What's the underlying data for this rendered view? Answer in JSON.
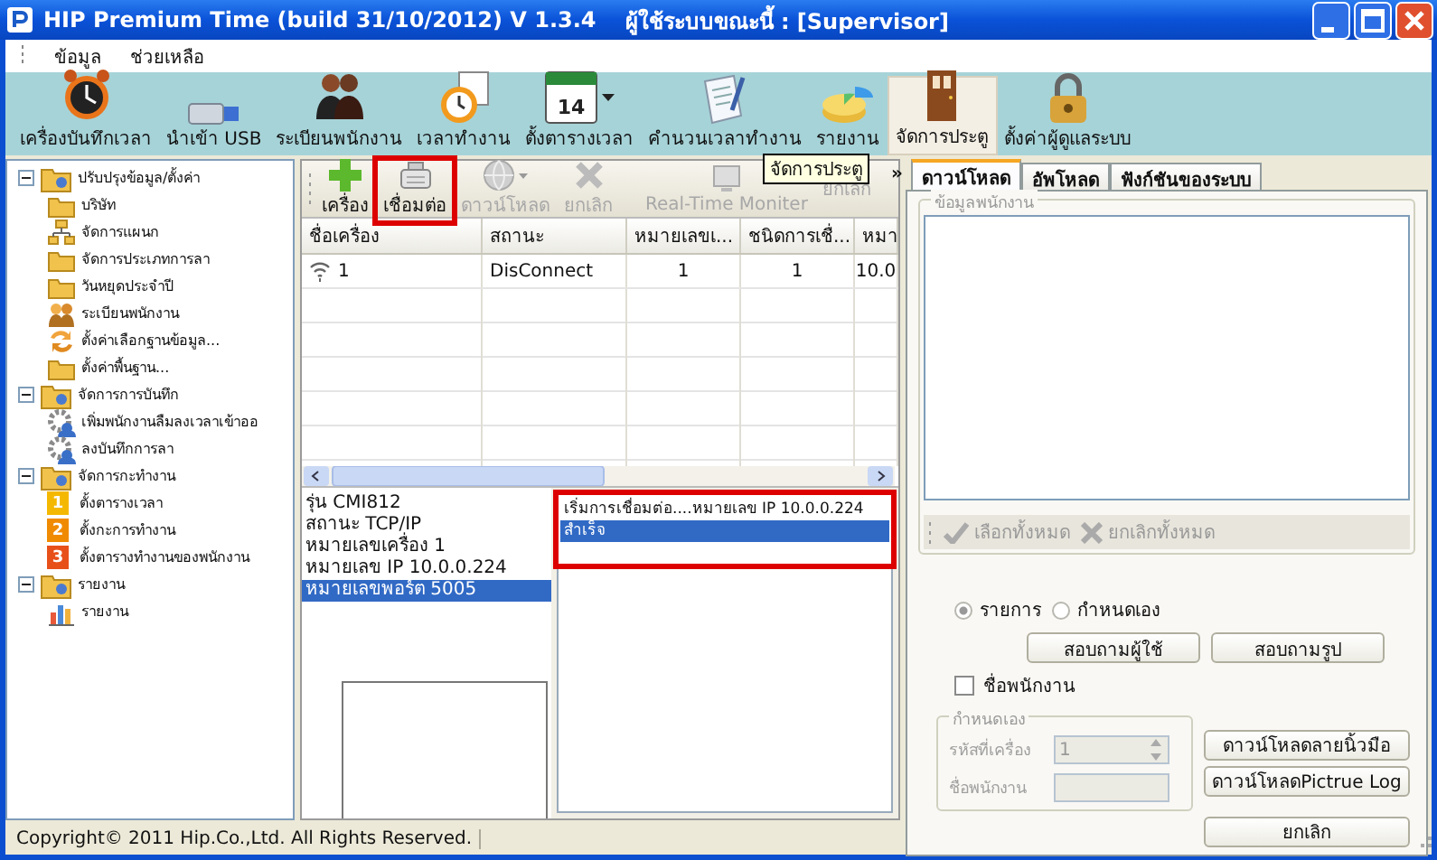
{
  "window": {
    "title": "HIP Premium Time (build 31/10/2012) V 1.3.4",
    "user": "ผู้ใช้ระบบขณะนี้ : [Supervisor]"
  },
  "menu": [
    "ข้อมูล",
    "ช่วยเหลือ"
  ],
  "toolbar": [
    {
      "label": "เครื่องบันทึกเวลา",
      "selected": false
    },
    {
      "label": "นำเข้า USB",
      "selected": false
    },
    {
      "label": "ระเบียนพนักงาน",
      "selected": false
    },
    {
      "label": "เวลาทำงาน",
      "selected": false
    },
    {
      "label": "ตั้งตารางเวลา",
      "badge": "14",
      "dropdown": true,
      "selected": false
    },
    {
      "label": "คำนวนเวลาทำงาน",
      "selected": false
    },
    {
      "label": "รายงาน",
      "selected": false
    },
    {
      "label": "จัดการประตู",
      "selected": true
    },
    {
      "label": "ตั้งค่าผู้ดูแลระบบ",
      "selected": false
    }
  ],
  "tree": [
    {
      "label": "ปรับปรุงข้อมูล/ตั้งค่า",
      "expanded": true,
      "children": [
        {
          "label": "บริษัท"
        },
        {
          "label": "จัดการแผนก"
        },
        {
          "label": "จัดการประเภทการลา"
        },
        {
          "label": "วันหยุดประจำปี"
        },
        {
          "label": "ระเบียนพนักงาน"
        },
        {
          "label": "ตั้งค่าเลือกฐานข้อมูล..."
        },
        {
          "label": "ตั้งค่าพื้นฐาน..."
        }
      ]
    },
    {
      "label": "จัดการการบันทึก",
      "expanded": true,
      "children": [
        {
          "label": "เพิ่มพนักงานลืมลงเวลาเข้าออ"
        },
        {
          "label": "ลงบันทึกการลา"
        }
      ]
    },
    {
      "label": "จัดการกะทำงาน",
      "expanded": true,
      "children": [
        {
          "label": "ตั้งตารางเวลา",
          "badge": "1",
          "color": "#f5b800"
        },
        {
          "label": "ตั้งกะการทำงาน",
          "badge": "2",
          "color": "#f08a00"
        },
        {
          "label": "ตั้งตารางทำงานของพนักงาน",
          "badge": "3",
          "color": "#e8501a"
        }
      ]
    },
    {
      "label": "รายงาน",
      "expanded": true,
      "children": [
        {
          "label": "รายงาน"
        }
      ]
    }
  ],
  "device_toolbar": {
    "buttons": [
      {
        "label": "เครื่อง",
        "disabled": false,
        "highlighted": false
      },
      {
        "label": "เชื่อมต่อ",
        "disabled": false,
        "highlighted": true
      },
      {
        "label": "ดาวน์โหลด",
        "disabled": true,
        "dropdown": true,
        "highlighted": false
      },
      {
        "label": "ยกเลิก",
        "disabled": true,
        "highlighted": false
      },
      {
        "label": "Real-Time Moniter",
        "disabled": true,
        "highlighted": false
      },
      {
        "label": "ยกเลิก",
        "disabled": true,
        "highlighted": false
      }
    ],
    "overflow": "»",
    "tooltip": "จัดการประตู"
  },
  "table": {
    "columns": [
      "ชื่อเครื่อง",
      "สถานะ",
      "หมายเลขเ...",
      "ชนิดการเชื่...",
      "หมา"
    ],
    "rows": [
      [
        "1",
        "DisConnect",
        "1",
        "1",
        "10.0"
      ]
    ]
  },
  "device_info": [
    {
      "text": "รุ่น  CMI812",
      "selected": false
    },
    {
      "text": "สถานะ  TCP/IP",
      "selected": false
    },
    {
      "text": "หมายเลขเครื่อง  1",
      "selected": false
    },
    {
      "text": "หมายเลข IP   10.0.0.224",
      "selected": false
    },
    {
      "text": "หมายเลขพอร์ต  5005",
      "selected": true
    }
  ],
  "log": {
    "highlighted": true,
    "lines": [
      {
        "text": "เริ่มการเชื่อมต่อ....หมายเลข IP   10.0.0.224",
        "selected": false
      },
      {
        "text": "สำเร็จ",
        "selected": true
      }
    ]
  },
  "right_panel": {
    "tabs": [
      {
        "label": "ดาวน์โหลด",
        "selected": true
      },
      {
        "label": "อัพโหลด",
        "selected": false
      },
      {
        "label": "ฟังก์ชันของระบบ",
        "selected": false
      }
    ],
    "employee_group": "ข้อมูลพนักงาน",
    "list_tools": [
      {
        "label": "เลือกทั้งหมด",
        "disabled": true
      },
      {
        "label": "ยกเลิกทั้งหมด",
        "disabled": true
      }
    ],
    "radios": [
      {
        "label": "รายการ",
        "selected": true
      },
      {
        "label": "กำหนดเอง",
        "selected": false
      }
    ],
    "query_buttons": [
      "สอบถามผู้ใช้",
      "สอบถามรูป"
    ],
    "name_checkbox": {
      "label": "ชื่อพนักงาน",
      "checked": false
    },
    "custom_group": {
      "title": "กำหนดเอง",
      "disabled": true,
      "fields": [
        {
          "label": "รหัสที่เครื่อง",
          "value": "1",
          "kind": "spin"
        },
        {
          "label": "ชื่อพนักงาน",
          "kind": "text"
        }
      ]
    },
    "action_buttons": [
      "ดาวน์โหลดลายนิ้วมือ",
      "ดาวน์โหลดPictrue Log",
      "ยกเลิก"
    ]
  },
  "status_bar": "Copyright© 2011 Hip.Co.,Ltd. All Rights Reserved."
}
